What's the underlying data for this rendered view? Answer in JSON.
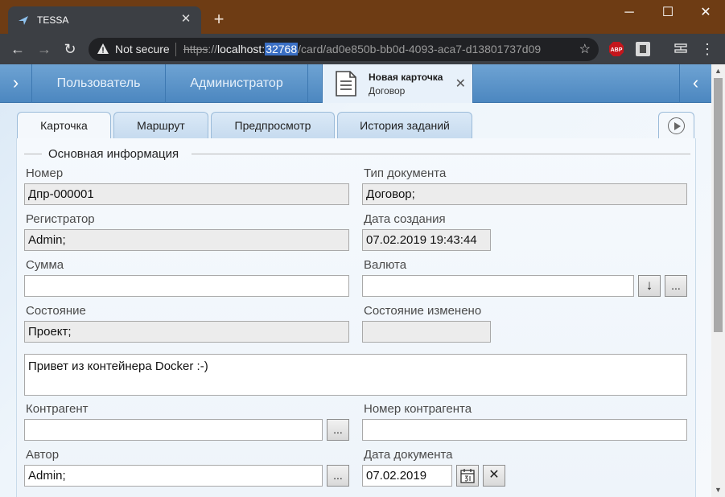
{
  "browser": {
    "tab_title": "TESSA",
    "tab_close": "✕",
    "new_tab": "+",
    "window": {
      "minimize": "─",
      "maximize": "☐",
      "close": "✕"
    },
    "nav": {
      "back": "←",
      "forward": "→",
      "reload": "↻"
    },
    "not_secure": "Not secure",
    "url": {
      "scheme": "https",
      "sep": "://",
      "host": "localhost:",
      "port": "32768",
      "path": "/card/ad0e850b-bb0d-4093-aca7-d13801737d09"
    },
    "star": "☆",
    "menu": "⋮",
    "extensions": [
      "abp-icon",
      "extension-icon",
      "cast-icon"
    ]
  },
  "app": {
    "nav_left": "›",
    "nav_right": "‹",
    "menu": [
      "Пользователь",
      "Администратор"
    ],
    "card_tab": {
      "title": "Новая карточка",
      "subtitle": "Договор",
      "close": "✕"
    },
    "tabs": [
      "Карточка",
      "Маршрут",
      "Предпросмотр",
      "История заданий"
    ],
    "section_title": "Основная информация"
  },
  "form": {
    "number_label": "Номер",
    "number_value": "Дпр-000001",
    "doctype_label": "Тип документа",
    "doctype_value": "Договор;",
    "registrar_label": "Регистратор",
    "registrar_value": "Admin;",
    "created_label": "Дата создания",
    "created_value": "07.02.2019 19:43:44",
    "sum_label": "Сумма",
    "sum_value": "",
    "currency_label": "Валюта",
    "currency_value": "",
    "currency_down": "↓",
    "currency_more": "...",
    "state_label": "Состояние",
    "state_value": "Проект;",
    "state_changed_label": "Состояние изменено",
    "state_changed_value": "",
    "comment_value": "Привет из контейнера Docker :-)",
    "partner_label": "Контрагент",
    "partner_value": "",
    "partner_more": "...",
    "partner_number_label": "Номер контрагента",
    "partner_number_value": "",
    "author_label": "Автор",
    "author_value": "Admin;",
    "author_more": "...",
    "docdate_label": "Дата документа",
    "docdate_value": "07.02.2019",
    "docdate_clear": "✕"
  },
  "scroll": {
    "up": "▲",
    "down": "▼"
  }
}
